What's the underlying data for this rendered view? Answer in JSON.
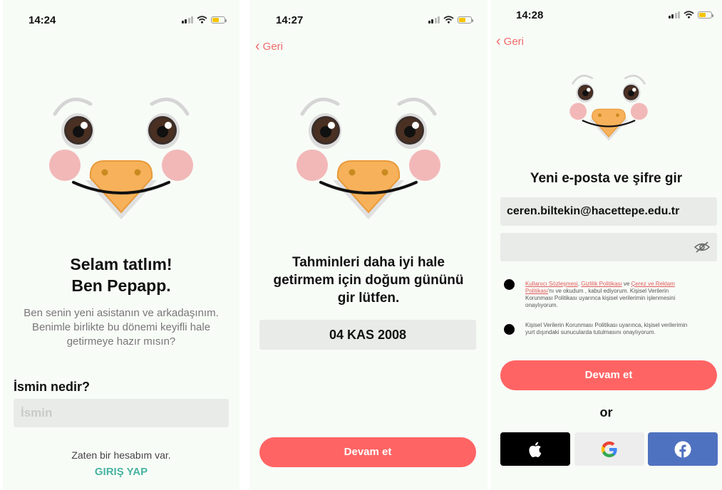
{
  "screen1": {
    "time": "14:24",
    "title_line1": "Selam tatlım!",
    "title_line2": "Ben Pepapp.",
    "subtitle_line1": "Ben senin yeni asistanın ve arkadaşınım.",
    "subtitle_line2": "Benimle birlikte bu dönemi keyifli hale",
    "subtitle_line3": "getirmeye hazır mısın?",
    "name_label": "İsmin nedir?",
    "name_placeholder": "İsmin",
    "account_text": "Zaten bir hesabım var.",
    "login_link": "GIRIŞ YAP"
  },
  "screen2": {
    "time": "14:27",
    "back_label": "Geri",
    "title_line1": "Tahminleri daha iyi hale",
    "title_line2": "getirmem için doğum gününü",
    "title_line3": "gir lütfen.",
    "date_value": "04 KAS 2008",
    "continue_label": "Devam et"
  },
  "screen3": {
    "time": "14:28",
    "back_label": "Geri",
    "title": "Yeni e-posta ve şifre gir",
    "email_value": "ceren.biltekin@hacettepe.edu.tr",
    "consent1": {
      "link1": "Kullanıcı Sözleşmesi",
      "sep1": ", ",
      "link2": "Gizlilik Politikası",
      "sep2": " ve ",
      "link3a": "Çerez ve Reklam",
      "link3b": "Politikası",
      "text1": "'nı ve okudum , kabul ediyorum. Kişisel Verilerin",
      "text2": "Korunması Politikası uyarınca kişisel verilerimin işlenmesini",
      "text3": "onaylıyorum."
    },
    "consent2": {
      "line1": "Kişisel Verilerin Korunması Politikası uyarınca, kişisel verilerimin",
      "line2": "yurt dışındaki sunucularda tutulmasını onaylıyorum."
    },
    "continue_label": "Devam et",
    "or_label": "or",
    "social": [
      {
        "icon": "apple-icon",
        "color": "#000000"
      },
      {
        "icon": "google-icon",
        "color": "#ededed"
      },
      {
        "icon": "facebook-icon",
        "color": "#4f72c0"
      }
    ]
  },
  "colors": {
    "accent": "#ff6464",
    "link_teal": "#47b3a3",
    "back_red": "#f06a6a",
    "background": "#f8fcf7"
  }
}
